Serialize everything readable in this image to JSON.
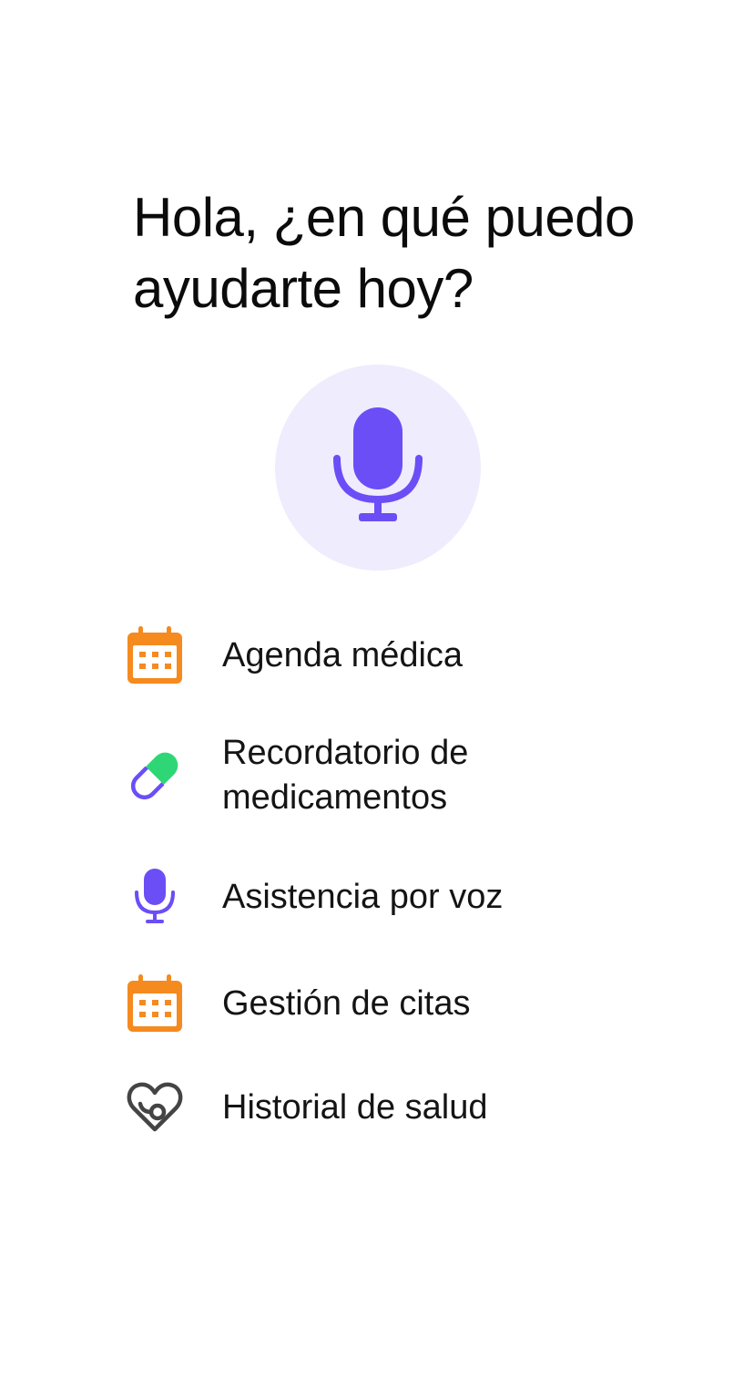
{
  "greeting": "Hola, ¿en qué puedo ayudarte hoy?",
  "mic_button": {
    "icon": "microphone-icon",
    "colors": {
      "background": "#efecfd",
      "icon": "#6b4ef6"
    }
  },
  "menu": {
    "items": [
      {
        "label": "Agenda médica",
        "icon": "calendar-icon",
        "color": "#f58a1f"
      },
      {
        "label": "Recordatorio de medicamentos",
        "icon": "pill-icon",
        "color": "#6b4ef6",
        "accent": "#2fd676"
      },
      {
        "label": "Asistencia por voz",
        "icon": "microphone-icon",
        "color": "#6b4ef6"
      },
      {
        "label": "Gestión de citas",
        "icon": "calendar-icon",
        "color": "#f58a1f"
      },
      {
        "label": "Historial de salud",
        "icon": "heart-stethoscope-icon",
        "color": "#444444"
      }
    ]
  }
}
